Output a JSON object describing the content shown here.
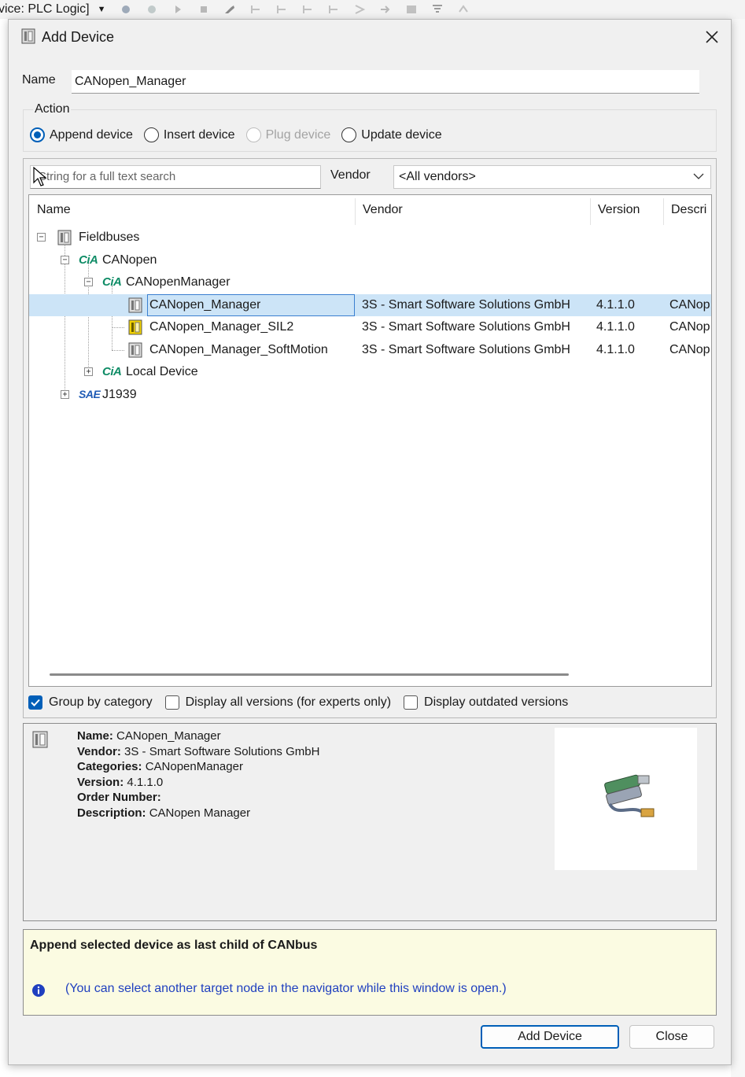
{
  "background": {
    "title_fragment": "vice: PLC Logic]"
  },
  "dialog": {
    "title": "Add Device",
    "name_label": "Name",
    "name_value": "CANopen_Manager",
    "action": {
      "legend": "Action",
      "options": [
        {
          "label": "Append device",
          "checked": true,
          "disabled": false
        },
        {
          "label": "Insert device",
          "checked": false,
          "disabled": false
        },
        {
          "label": "Plug device",
          "checked": false,
          "disabled": true
        },
        {
          "label": "Update device",
          "checked": false,
          "disabled": false
        }
      ]
    },
    "search": {
      "placeholder": "String for a full text search",
      "vendor_label": "Vendor",
      "vendor_value": "<All vendors>"
    },
    "table": {
      "columns": [
        "Name",
        "Vendor",
        "Version",
        "Descri"
      ],
      "rows": [
        {
          "name": "Fieldbuses",
          "vendor": "",
          "version": "",
          "desc": "",
          "icon": "device-icon"
        },
        {
          "name": "CANopen",
          "vendor": "",
          "version": "",
          "desc": "",
          "icon": "cia-logo-icon"
        },
        {
          "name": "CANopenManager",
          "vendor": "",
          "version": "",
          "desc": "",
          "icon": "cia-logo-icon"
        },
        {
          "name": "CANopen_Manager",
          "vendor": "3S - Smart Software Solutions GmbH",
          "version": "4.1.1.0",
          "desc": "CANop",
          "icon": "device-icon",
          "selected": true
        },
        {
          "name": "CANopen_Manager_SIL2",
          "vendor": "3S - Smart Software Solutions GmbH",
          "version": "4.1.1.0",
          "desc": "CANop",
          "icon": "device-sil2-icon"
        },
        {
          "name": "CANopen_Manager_SoftMotion",
          "vendor": "3S - Smart Software Solutions GmbH",
          "version": "4.1.1.0",
          "desc": "CANop",
          "icon": "device-icon"
        },
        {
          "name": "Local Device",
          "vendor": "",
          "version": "",
          "desc": "",
          "icon": "cia-logo-icon"
        },
        {
          "name": "J1939",
          "vendor": "",
          "version": "",
          "desc": "",
          "icon": "sae-logo-icon"
        }
      ],
      "logo_text": {
        "cia": "CiA",
        "sae": "SAE"
      }
    },
    "options": {
      "group_by_category": "Group by category",
      "display_all_versions": "Display all versions (for experts only)",
      "display_outdated": "Display outdated versions",
      "group_checked": true
    },
    "info": {
      "name_label": "Name:",
      "name_value": "CANopen_Manager",
      "vendor_label": "Vendor:",
      "vendor_value": "3S - Smart Software Solutions GmbH",
      "categories_label": "Categories:",
      "categories_value": "CANopenManager",
      "version_label": "Version:",
      "version_value": "4.1.1.0",
      "order_label": "Order Number:",
      "order_value": "",
      "description_label": "Description:",
      "description_value": "CANopen Manager"
    },
    "hint": {
      "title": "Append selected device as last child of CANbus",
      "note": "(You can select another target node in the navigator while this window is open.)"
    },
    "buttons": {
      "add": "Add Device",
      "close": "Close"
    },
    "colors": {
      "accent": "#005fb8",
      "selection": "#cce4f7",
      "hint_bg": "#fbfbe2",
      "cia_green": "#0f8c66"
    }
  }
}
